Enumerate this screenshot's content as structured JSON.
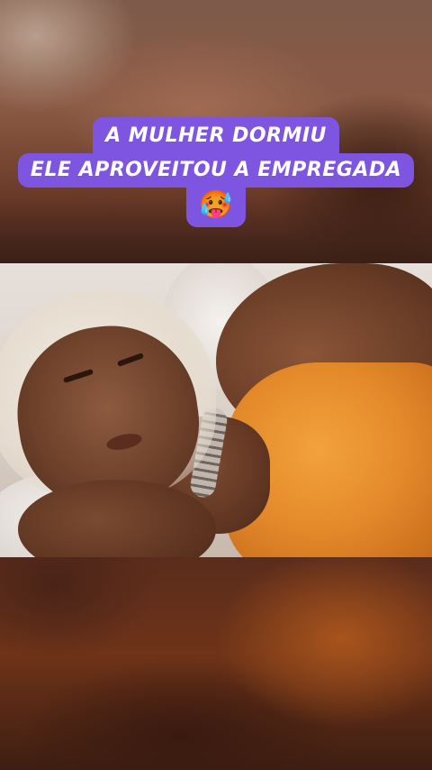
{
  "caption": {
    "line1": "A MULHER DORMIU",
    "line2": "ELE APROVEITOU A EMPREGADA",
    "emoji": "🥵",
    "background_color": "#7d55e0",
    "text_color": "#ffffff"
  },
  "video": {
    "subject": "sleeping-woman-photo"
  }
}
